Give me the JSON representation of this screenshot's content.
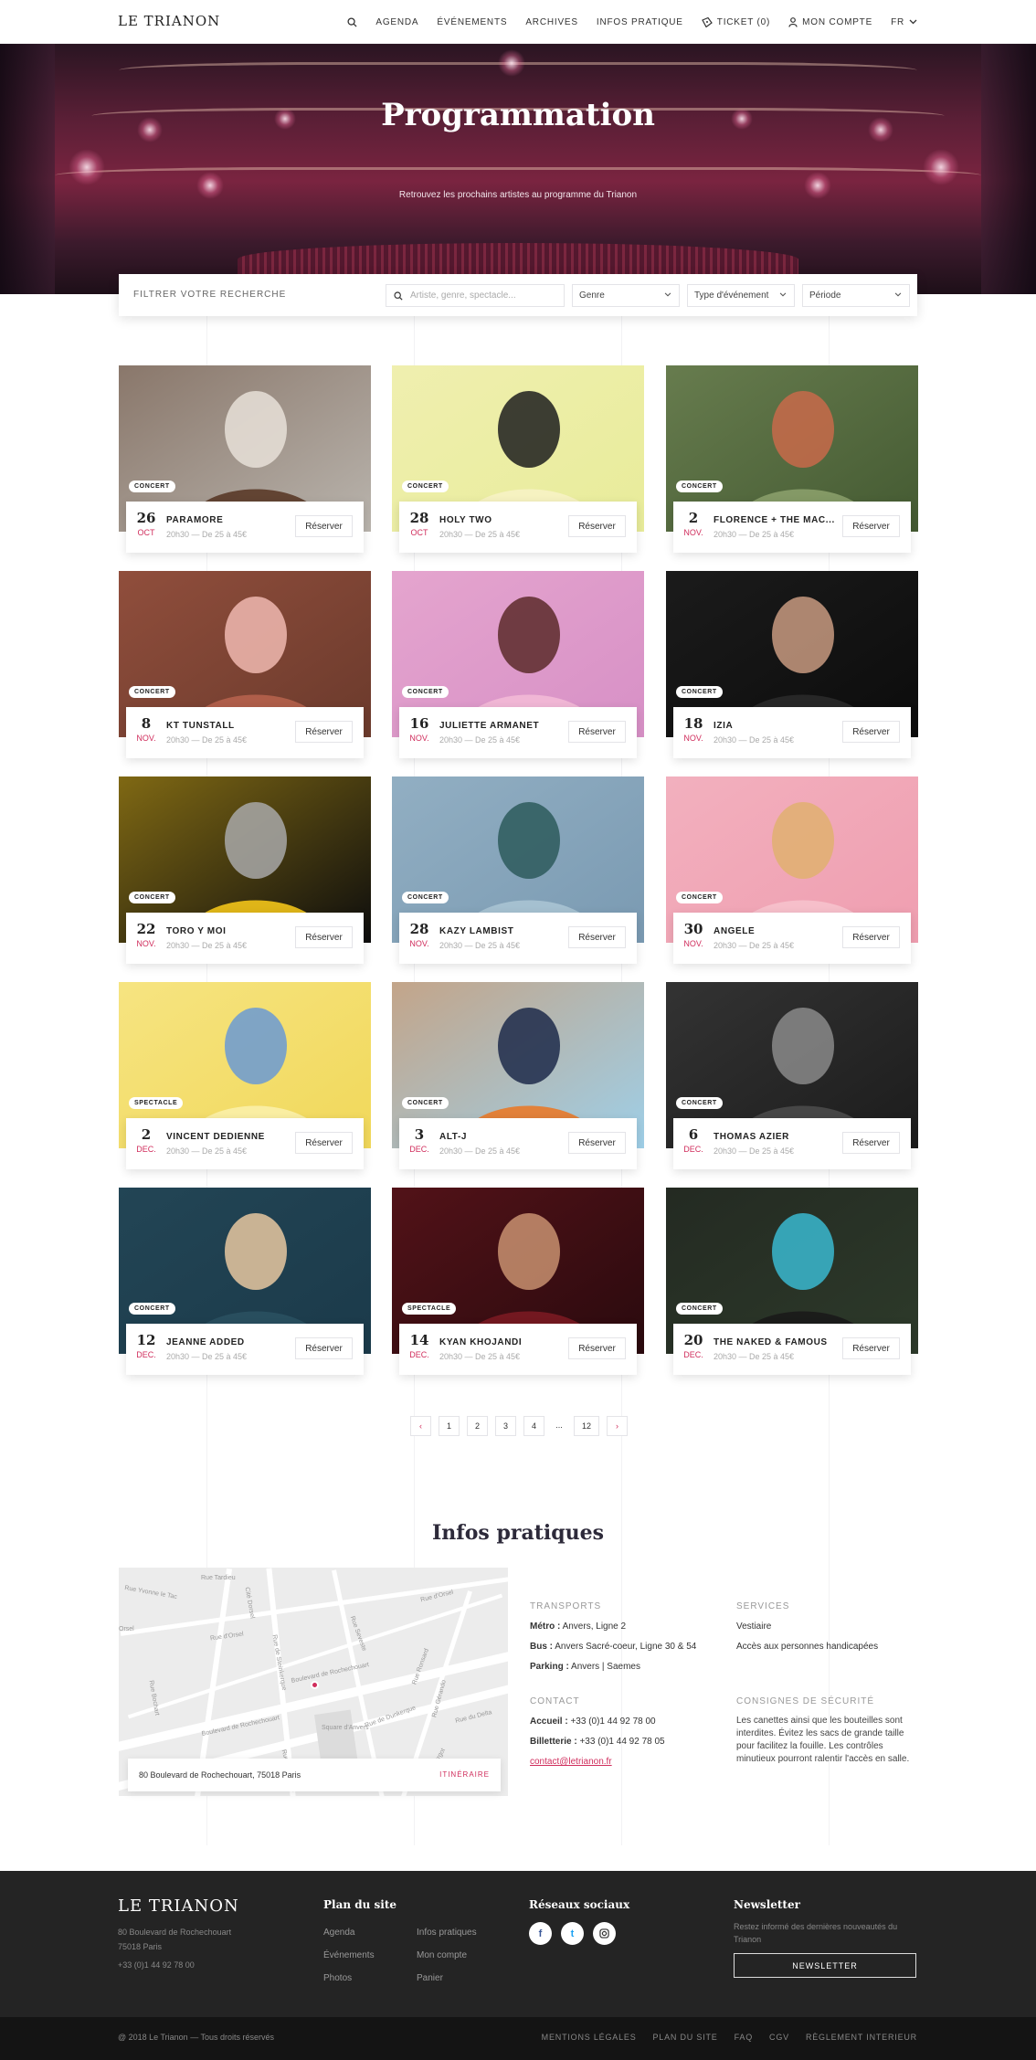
{
  "header": {
    "logo": "LE TRIANON",
    "nav": [
      "AGENDA",
      "ÉVÉNEMENTS",
      "ARCHIVES",
      "INFOS PRATIQUE"
    ],
    "ticket": "TICKET (0)",
    "account": "MON COMPTE",
    "lang": "FR"
  },
  "hero": {
    "title": "Programmation",
    "subtitle": "Retrouvez les prochains artistes au programme du Trianon"
  },
  "filter": {
    "label": "FILTRER VOTRE RECHERCHE",
    "search_placeholder": "Artiste, genre, spectacle...",
    "genre": "Genre",
    "type": "Type d'événement",
    "period": "Période"
  },
  "events": [
    {
      "day": "26",
      "month": "OCT",
      "name": "PARAMORE",
      "meta": "20h30 — De 25 à 45€",
      "tag": "CONCERT",
      "button": "Réserver",
      "colors": [
        "#b9b4ad",
        "#5a3a28",
        "#e8e0d8"
      ]
    },
    {
      "day": "28",
      "month": "OCT",
      "name": "HOLY TWO",
      "meta": "20h30 — De 25 à 45€",
      "tag": "CONCERT",
      "button": "Réserver",
      "colors": [
        "#e8ec9a",
        "#f7f2c4",
        "#1d1d1d"
      ]
    },
    {
      "day": "2",
      "month": "NOV.",
      "name": "FLORENCE + THE MAC...",
      "meta": "20h30 — De 25 à 45€",
      "tag": "CONCERT",
      "button": "Réserver",
      "colors": [
        "#445a32",
        "#8a9e6a",
        "#c86a4a"
      ]
    },
    {
      "day": "8",
      "month": "NOV.",
      "name": "KT TUNSTALL",
      "meta": "20h30 — De 25 à 45€",
      "tag": "CONCERT",
      "button": "Réserver",
      "colors": [
        "#6b3a2c",
        "#b5624c",
        "#f0b8b0"
      ]
    },
    {
      "day": "16",
      "month": "NOV.",
      "name": "JULIETTE ARMANET",
      "meta": "20h30 — De 25 à 45€",
      "tag": "CONCERT",
      "button": "Réserver",
      "colors": [
        "#d790c6",
        "#f2b9d6",
        "#5c2a2a"
      ]
    },
    {
      "day": "18",
      "month": "NOV.",
      "name": "IZIA",
      "meta": "20h30 — De 25 à 45€",
      "tag": "CONCERT",
      "button": "Réserver",
      "colors": [
        "#0c0c0c",
        "#2a2a2a",
        "#c89a80"
      ]
    },
    {
      "day": "22",
      "month": "NOV.",
      "name": "TORO Y MOI",
      "meta": "20h30 — De 25 à 45€",
      "tag": "CONCERT",
      "button": "Réserver",
      "colors": [
        "#0d0d0d",
        "#f2c41a",
        "#a8a8a8"
      ]
    },
    {
      "day": "28",
      "month": "NOV.",
      "name": "KAZY LAMBIST",
      "meta": "20h30 — De 25 à 45€",
      "tag": "CONCERT",
      "button": "Réserver",
      "colors": [
        "#7a9ab2",
        "#a9c3d3",
        "#2d5a5c"
      ]
    },
    {
      "day": "30",
      "month": "NOV.",
      "name": "ANGÈLE",
      "meta": "20h30 — De 25 à 45€",
      "tag": "CONCERT",
      "button": "Réserver",
      "colors": [
        "#ef9eb0",
        "#f6c2cc",
        "#e0b070"
      ]
    },
    {
      "day": "2",
      "month": "DEC.",
      "name": "VINCENT DEDIENNE",
      "meta": "20h30 — De 25 à 45€",
      "tag": "SPECTACLE",
      "button": "Réserver",
      "colors": [
        "#f1d85a",
        "#fbf0a8",
        "#6a9ad4"
      ]
    },
    {
      "day": "3",
      "month": "DEC.",
      "name": "ALT-J",
      "meta": "20h30 — De 25 à 45€",
      "tag": "CONCERT",
      "button": "Réserver",
      "colors": [
        "#9ecfe8",
        "#e87a2a",
        "#1d2a4a"
      ]
    },
    {
      "day": "6",
      "month": "DEC.",
      "name": "THOMAS AZIER",
      "meta": "20h30 — De 25 à 45€",
      "tag": "CONCERT",
      "button": "Réserver",
      "colors": [
        "#1c1c1c",
        "#4a4a4a",
        "#8a8a8a"
      ]
    },
    {
      "day": "12",
      "month": "DEC.",
      "name": "JEANNE ADDED",
      "meta": "20h30 — De 25 à 45€",
      "tag": "CONCERT",
      "button": "Réserver",
      "colors": [
        "#1b3a4a",
        "#2a5060",
        "#e8c8a0"
      ]
    },
    {
      "day": "14",
      "month": "DEC.",
      "name": "KYAN KHOJANDI",
      "meta": "20h30 — De 25 à 45€",
      "tag": "SPECTACLE",
      "button": "Réserver",
      "colors": [
        "#2a0a0e",
        "#7a1a22",
        "#c89070"
      ]
    },
    {
      "day": "20",
      "month": "DEC.",
      "name": "THE NAKED & FAMOUS",
      "meta": "20h30 — De 25 à 45€",
      "tag": "CONCERT",
      "button": "Réserver",
      "colors": [
        "#2d3a2a",
        "#1a1a1a",
        "#3ab8d0"
      ]
    }
  ],
  "pagination": [
    "‹",
    "1",
    "2",
    "3",
    "4",
    "...",
    "12",
    "›"
  ],
  "infos": {
    "title": "Infos pratiques",
    "address": "80 Boulevard de Rochechouart, 75018 Paris",
    "itinerary": "ITINÉRAIRE",
    "map_labels": [
      "Rue Tardieu",
      "Rue d'Orsel",
      "Rue Yvonne le Tac",
      "Rue d'Orsel",
      "Rue de Steinkerque",
      "Rue Seveste",
      "Rue Ronsard",
      "Boulevard de Rochechouart",
      "Boulevard de Rochechouart",
      "Rue de Dunkerque",
      "Rue Gérando",
      "Rue du Delta",
      "Rue Bochart",
      "Square d'Anvers",
      "Rue Condorcet",
      "Rue Turgot",
      "Orsel",
      "Cité Dorsel"
    ],
    "transports_head": "TRANSPORTS",
    "metro_label": "Métro :",
    "metro": "Anvers, Ligne 2",
    "bus_label": "Bus :",
    "bus": "Anvers Sacré-coeur, Ligne 30 & 54",
    "parking_label": "Parking :",
    "parking": "Anvers | Saemes",
    "contact_head": "CONTACT",
    "accueil_label": "Accueil :",
    "accueil": "+33 (0)1 44 92 78 00",
    "billetterie_label": "Billetterie :",
    "billetterie": "+33 (0)1 44 92 78 05",
    "email": "contact@letrianon.fr",
    "services_head": "SERVICES",
    "services": [
      "Vestiaire",
      "Accès aux personnes handicapées"
    ],
    "security_head": "CONSIGNES DE SÉCURITÉ",
    "security": "Les canettes ainsi que les bouteilles sont interdites. Évitez les sacs de grande taille pour facilitez la fouille. Les contrôles minutieux pourront ralentir l'accès en salle."
  },
  "footer": {
    "logo": "LE TRIANON",
    "address1": "80 Boulevard de Rochechouart",
    "address2": "75018 Paris",
    "phone": "+33 (0)1 44 92 78 00",
    "plan_head": "Plan du site",
    "plan_col1": [
      "Agenda",
      "Événements",
      "Photos"
    ],
    "plan_col2": [
      "Infos pratiques",
      "Mon compte",
      "Panier"
    ],
    "social_head": "Réseaux sociaux",
    "social": [
      "f",
      "t",
      "i"
    ],
    "newsletter_head": "Newsletter",
    "newsletter_text": "Restez informé des dernières nouveautés du Trianon",
    "newsletter_button": "NEWSLETTER",
    "copyright": "@ 2018 Le Trianon — Tous droits réservés",
    "legal": [
      "MENTIONS LÉGALES",
      "PLAN DU SITE",
      "FAQ",
      "CGV",
      "RÈGLEMENT INTERIEUR"
    ]
  },
  "theme": {
    "accent": "#d02d5c",
    "dark": "#242424"
  }
}
